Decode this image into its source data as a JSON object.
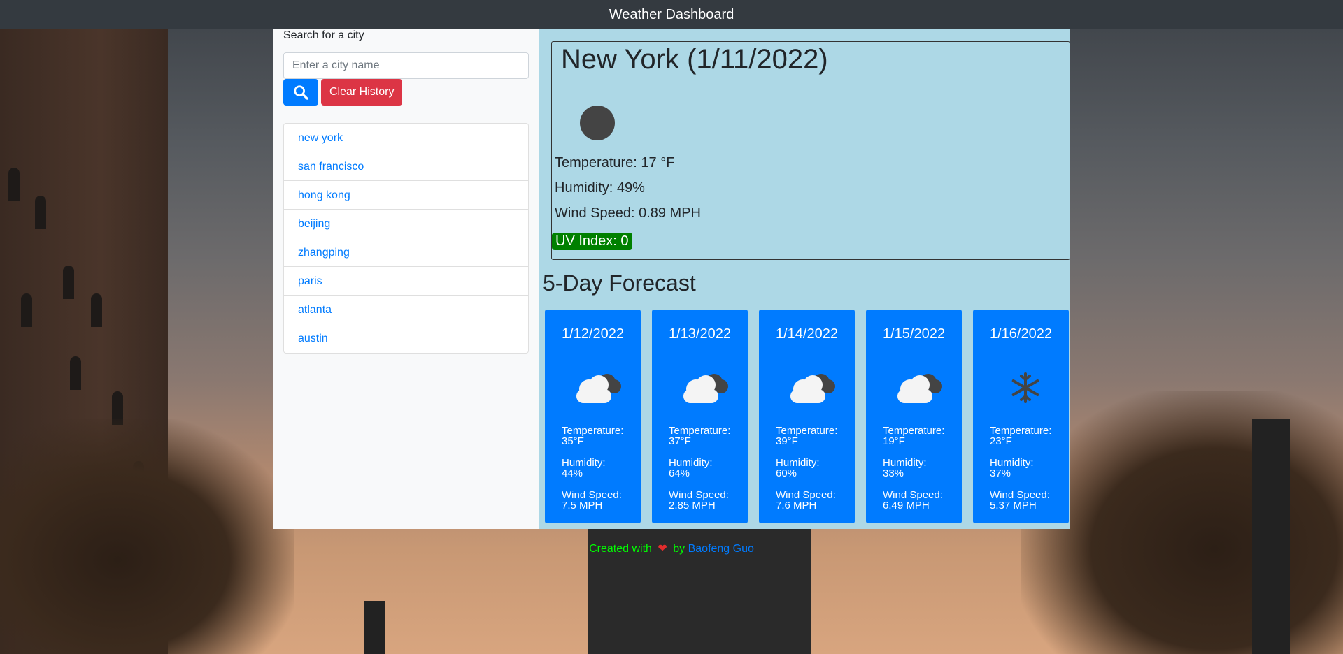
{
  "header": {
    "title": "Weather Dashboard"
  },
  "sidebar": {
    "search_label": "Search for a city",
    "search_placeholder": "Enter a city name",
    "search_icon": "search-icon",
    "clear_label": "Clear History",
    "history": [
      "new york",
      "san francisco",
      "hong kong",
      "beijing",
      "zhangping",
      "paris",
      "atlanta",
      "austin"
    ]
  },
  "current": {
    "title": "New York (1/11/2022)",
    "icon": "night-clear-icon",
    "temperature": "Temperature: 17 °F",
    "humidity": "Humidity: 49%",
    "wind": "Wind Speed: 0.89 MPH",
    "uv": "UV Index: 0",
    "uv_color": "#008000"
  },
  "forecast": {
    "title": "5-Day Forecast",
    "days": [
      {
        "date": "1/12/2022",
        "icon": "cloudy-icon",
        "temp_label": "Temperature:",
        "temp": "35°F",
        "hum_label": "Humidity:",
        "hum": "44%",
        "wind_label": "Wind Speed:",
        "wind": "7.5 MPH"
      },
      {
        "date": "1/13/2022",
        "icon": "cloudy-icon",
        "temp_label": "Temperature:",
        "temp": "37°F",
        "hum_label": "Humidity:",
        "hum": "64%",
        "wind_label": "Wind Speed:",
        "wind": "2.85 MPH"
      },
      {
        "date": "1/14/2022",
        "icon": "cloudy-icon",
        "temp_label": "Temperature:",
        "temp": "39°F",
        "hum_label": "Humidity:",
        "hum": "60%",
        "wind_label": "Wind Speed:",
        "wind": "7.6 MPH"
      },
      {
        "date": "1/15/2022",
        "icon": "cloudy-icon",
        "temp_label": "Temperature:",
        "temp": "19°F",
        "hum_label": "Humidity:",
        "hum": "33%",
        "wind_label": "Wind Speed:",
        "wind": "6.49 MPH"
      },
      {
        "date": "1/16/2022",
        "icon": "snow-icon",
        "temp_label": "Temperature:",
        "temp": "23°F",
        "hum_label": "Humidity:",
        "hum": "37%",
        "wind_label": "Wind Speed:",
        "wind": "5.37 MPH"
      }
    ]
  },
  "footer": {
    "created_with": "Created with",
    "heart": "❤",
    "by": "by",
    "author": "Baofeng Guo"
  },
  "colors": {
    "navbar": "#343a40",
    "accent": "#007bff",
    "danger": "#dc3545",
    "main_bg": "#add8e6",
    "footer_text": "#00ff00"
  }
}
